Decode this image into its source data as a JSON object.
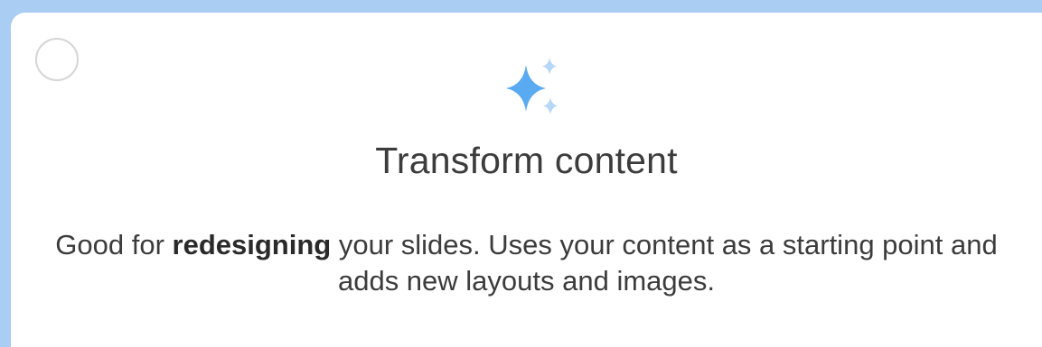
{
  "card": {
    "title": "Transform content",
    "description": {
      "prefix": "Good for ",
      "emphasis": "redesigning",
      "suffix": " your slides. Uses your content as a starting point and adds new layouts and images."
    },
    "icon": "sparkle-icon",
    "selected": false
  },
  "colors": {
    "frame": "#a9cdf3",
    "icon_primary": "#5aaaf2",
    "icon_secondary": "#b6d8f8",
    "text": "#3c3c3c",
    "radio_border": "#d6d6d6"
  }
}
